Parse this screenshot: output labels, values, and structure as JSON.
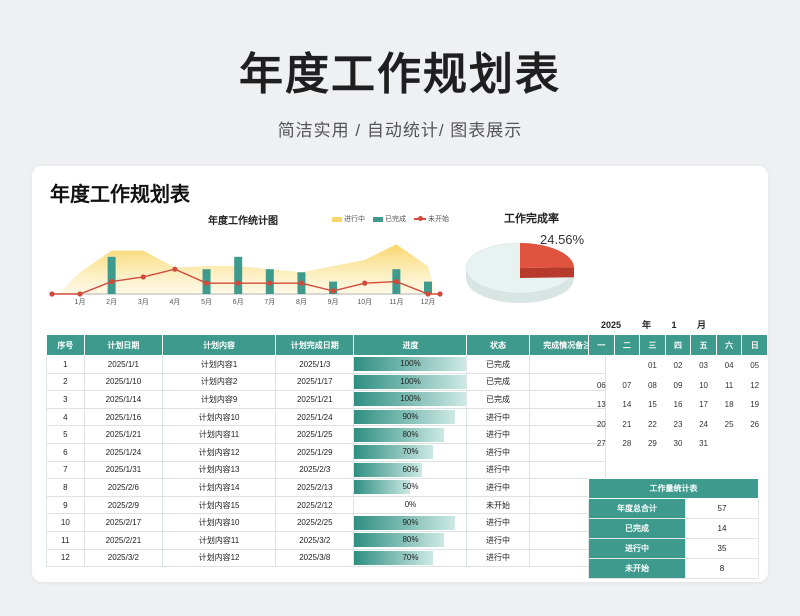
{
  "hero": {
    "title": "年度工作规划表",
    "subtitle": "简洁实用 / 自动统计/ 图表展示"
  },
  "sheet": {
    "title": "年度工作规划表"
  },
  "colors": {
    "accent": "#3d9a8c",
    "line": "#d24a3b",
    "area": "#f9d66a",
    "pie_done": "#e0533f",
    "pie_rest": "#e8f2f0"
  },
  "chart_data": [
    {
      "type": "bar",
      "title": "年度工作统计图",
      "categories": [
        "1月",
        "2月",
        "3月",
        "4月",
        "5月",
        "6月",
        "7月",
        "8月",
        "9月",
        "10月",
        "11月",
        "12月"
      ],
      "series": [
        {
          "name": "进行中",
          "kind": "area",
          "values": [
            14,
            28,
            28,
            17,
            18,
            18,
            16,
            14,
            18,
            22,
            32,
            18
          ]
        },
        {
          "name": "已完成",
          "kind": "bar",
          "values": [
            0,
            24,
            0,
            0,
            16,
            24,
            16,
            14,
            8,
            0,
            16,
            8
          ]
        },
        {
          "name": "未开始",
          "kind": "line",
          "values": [
            0,
            8,
            11,
            16,
            7,
            7,
            7,
            7,
            2,
            7,
            8,
            0
          ]
        }
      ],
      "ylim": [
        0,
        40
      ]
    },
    {
      "type": "pie",
      "title": "工作完成率",
      "label": "24.56%",
      "values": [
        24.56,
        75.44
      ]
    }
  ],
  "table": {
    "headers": [
      "序号",
      "计划日期",
      "计划内容",
      "计划完成日期",
      "进度",
      "状态",
      "完成情况备注"
    ],
    "rows": [
      {
        "no": "1",
        "date": "2025/1/1",
        "content": "计划内容1",
        "due": "2025/1/3",
        "progress": "100%",
        "pv": 100,
        "status": "已完成",
        "note": ""
      },
      {
        "no": "2",
        "date": "2025/1/10",
        "content": "计划内容2",
        "due": "2025/1/17",
        "progress": "100%",
        "pv": 100,
        "status": "已完成",
        "note": ""
      },
      {
        "no": "3",
        "date": "2025/1/14",
        "content": "计划内容9",
        "due": "2025/1/21",
        "progress": "100%",
        "pv": 100,
        "status": "已完成",
        "note": ""
      },
      {
        "no": "4",
        "date": "2025/1/16",
        "content": "计划内容10",
        "due": "2025/1/24",
        "progress": "90%",
        "pv": 90,
        "status": "进行中",
        "note": ""
      },
      {
        "no": "5",
        "date": "2025/1/21",
        "content": "计划内容11",
        "due": "2025/1/25",
        "progress": "80%",
        "pv": 80,
        "status": "进行中",
        "note": ""
      },
      {
        "no": "6",
        "date": "2025/1/24",
        "content": "计划内容12",
        "due": "2025/1/29",
        "progress": "70%",
        "pv": 70,
        "status": "进行中",
        "note": ""
      },
      {
        "no": "7",
        "date": "2025/1/31",
        "content": "计划内容13",
        "due": "2025/2/3",
        "progress": "60%",
        "pv": 60,
        "status": "进行中",
        "note": ""
      },
      {
        "no": "8",
        "date": "2025/2/6",
        "content": "计划内容14",
        "due": "2025/2/13",
        "progress": "50%",
        "pv": 50,
        "status": "进行中",
        "note": ""
      },
      {
        "no": "9",
        "date": "2025/2/9",
        "content": "计划内容15",
        "due": "2025/2/12",
        "progress": "0%",
        "pv": 0,
        "status": "未开始",
        "note": ""
      },
      {
        "no": "10",
        "date": "2025/2/17",
        "content": "计划内容10",
        "due": "2025/2/25",
        "progress": "90%",
        "pv": 90,
        "status": "进行中",
        "note": ""
      },
      {
        "no": "11",
        "date": "2025/2/21",
        "content": "计划内容11",
        "due": "2025/3/2",
        "progress": "80%",
        "pv": 80,
        "status": "进行中",
        "note": ""
      },
      {
        "no": "12",
        "date": "2025/3/2",
        "content": "计划内容12",
        "due": "2025/3/8",
        "progress": "70%",
        "pv": 70,
        "status": "进行中",
        "note": ""
      }
    ]
  },
  "calendar": {
    "year": "2025",
    "year_label": "年",
    "month": "1",
    "month_label": "月",
    "weekdays": [
      "一",
      "二",
      "三",
      "四",
      "五",
      "六",
      "日"
    ],
    "weeks": [
      [
        "",
        "",
        "01",
        "02",
        "03",
        "04",
        "05"
      ],
      [
        "06",
        "07",
        "08",
        "09",
        "10",
        "11",
        "12"
      ],
      [
        "13",
        "14",
        "15",
        "16",
        "17",
        "18",
        "19"
      ],
      [
        "20",
        "21",
        "22",
        "23",
        "24",
        "25",
        "26"
      ],
      [
        "27",
        "28",
        "29",
        "30",
        "31",
        "",
        ""
      ],
      [
        "",
        "",
        "",
        "",
        "",
        "",
        ""
      ]
    ]
  },
  "stats": {
    "title": "工作量统计表",
    "rows": [
      {
        "label": "年度总合计",
        "value": "57"
      },
      {
        "label": "已完成",
        "value": "14"
      },
      {
        "label": "进行中",
        "value": "35"
      },
      {
        "label": "未开始",
        "value": "8"
      }
    ]
  }
}
